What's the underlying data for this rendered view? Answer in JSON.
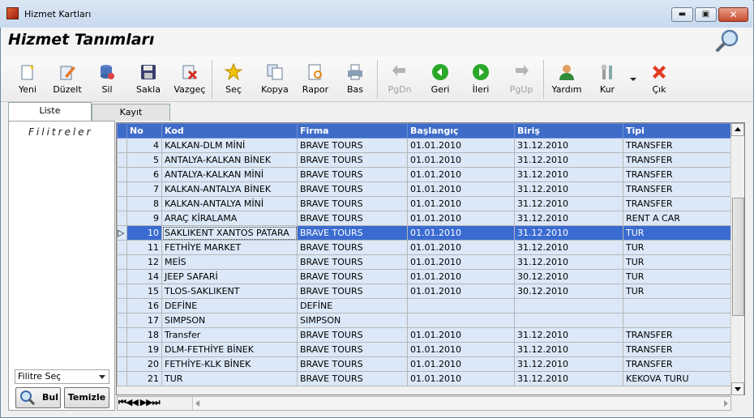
{
  "window": {
    "title": "Hizmet Kartları",
    "min_glyph": "▬",
    "max_glyph": "▣",
    "close_glyph": "✕"
  },
  "header": {
    "title": "Hizmet Tanımları"
  },
  "toolbar": {
    "yeni": "Yeni",
    "duzelt": "Düzelt",
    "sil": "Sil",
    "sakla": "Sakla",
    "vazgec": "Vazgeç",
    "sec": "Seç",
    "kopya": "Kopya",
    "rapor": "Rapor",
    "bas": "Bas",
    "pgdn": "PgDn",
    "geri": "Geri",
    "ileri": "İleri",
    "pgup": "PgUp",
    "yardim": "Yardım",
    "kur": "Kur",
    "cik": "Çık"
  },
  "tabs": {
    "liste": "Liste",
    "kayit": "Kayıt"
  },
  "filter": {
    "title": "Filitreler",
    "select_value": "Filitre Seç",
    "bul": "Bul",
    "temizle": "Temizle"
  },
  "grid": {
    "headers": {
      "no": "No",
      "kod": "Kod",
      "firma": "Firma",
      "baslangic": "Başlangıç",
      "bitis": "Biriş",
      "tipi": "Tipi"
    },
    "rows": [
      {
        "no": "4",
        "kod": "KALKAN-DLM MİNİ",
        "firma": "BRAVE TOURS",
        "bas": "01.01.2010",
        "bit": "31.12.2010",
        "tip": "TRANSFER"
      },
      {
        "no": "5",
        "kod": "ANTALYA-KALKAN BİNEK",
        "firma": "BRAVE TOURS",
        "bas": "01.01.2010",
        "bit": "31.12.2010",
        "tip": "TRANSFER"
      },
      {
        "no": "6",
        "kod": "ANTALYA-KALKAN MİNİ",
        "firma": "BRAVE TOURS",
        "bas": "01.01.2010",
        "bit": "31.12.2010",
        "tip": "TRANSFER"
      },
      {
        "no": "7",
        "kod": "KALKAN-ANTALYA BİNEK",
        "firma": "BRAVE TOURS",
        "bas": "01.01.2010",
        "bit": "31.12.2010",
        "tip": "TRANSFER"
      },
      {
        "no": "8",
        "kod": "KALKAN-ANTALYA MİNİ",
        "firma": "BRAVE TOURS",
        "bas": "01.01.2010",
        "bit": "31.12.2010",
        "tip": "TRANSFER"
      },
      {
        "no": "9",
        "kod": "ARAÇ KİRALAMA",
        "firma": "BRAVE TOURS",
        "bas": "01.01.2010",
        "bit": "31.12.2010",
        "tip": "RENT A CAR"
      },
      {
        "no": "10",
        "kod": "SAKLIKENT XANTOS PATARA",
        "firma": "BRAVE TOURS",
        "bas": "01.01.2010",
        "bit": "31.12.2010",
        "tip": "TUR"
      },
      {
        "no": "11",
        "kod": "FETHİYE MARKET",
        "firma": "BRAVE TOURS",
        "bas": "01.01.2010",
        "bit": "31.12.2010",
        "tip": "TUR"
      },
      {
        "no": "12",
        "kod": "MEİS",
        "firma": "BRAVE TOURS",
        "bas": "01.01.2010",
        "bit": "31.12.2010",
        "tip": "TUR"
      },
      {
        "no": "14",
        "kod": "JEEP SAFARİ",
        "firma": "BRAVE TOURS",
        "bas": "01.01.2010",
        "bit": "30.12.2010",
        "tip": "TUR"
      },
      {
        "no": "15",
        "kod": "TLOS-SAKLIKENT",
        "firma": "BRAVE TOURS",
        "bas": "01.01.2010",
        "bit": "30.12.2010",
        "tip": "TUR"
      },
      {
        "no": "16",
        "kod": "DEFİNE",
        "firma": "DEFİNE",
        "bas": "",
        "bit": "",
        "tip": ""
      },
      {
        "no": "17",
        "kod": "SIMPSON",
        "firma": "SIMPSON",
        "bas": "",
        "bit": "",
        "tip": ""
      },
      {
        "no": "18",
        "kod": "Transfer",
        "firma": "BRAVE TOURS",
        "bas": "01.01.2010",
        "bit": "31.12.2010",
        "tip": "TRANSFER"
      },
      {
        "no": "19",
        "kod": "DLM-FETHİYE BİNEK",
        "firma": "BRAVE TOURS",
        "bas": "01.01.2010",
        "bit": "31.12.2010",
        "tip": "TRANSFER"
      },
      {
        "no": "20",
        "kod": "FETHİYE-KLK BİNEK",
        "firma": "BRAVE TOURS",
        "bas": "01.01.2010",
        "bit": "31.12.2010",
        "tip": "TRANSFER"
      },
      {
        "no": "21",
        "kod": "TUR",
        "firma": "BRAVE TOURS",
        "bas": "01.01.2010",
        "bit": "31.12.2010",
        "tip": "KEKOVA TURU"
      }
    ],
    "selected_no": "10",
    "row_indicator": "▷"
  },
  "nav": {
    "buttons": "⏮◀◀ ▶▶⏭"
  },
  "colors": {
    "header_bg": "#3e6cc8",
    "row_bg": "#dbe8f7",
    "selected_bg": "#3a6bd1"
  }
}
